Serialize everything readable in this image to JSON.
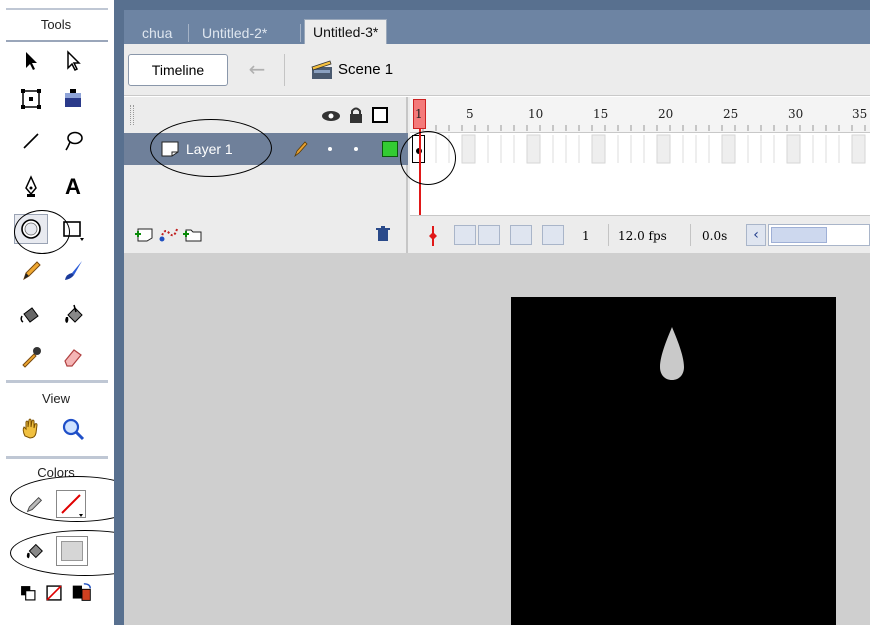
{
  "tools_panel": {
    "title": "Tools",
    "sections": {
      "view": "View",
      "colors": "Colors"
    },
    "tools": [
      {
        "name": "selection-tool",
        "icon": "arrow-icon"
      },
      {
        "name": "subselection-tool",
        "icon": "hollow-arrow-icon"
      },
      {
        "name": "free-transform-tool",
        "icon": "transform-icon"
      },
      {
        "name": "gradient-transform-tool",
        "icon": "gradient-transform-icon"
      },
      {
        "name": "line-tool",
        "icon": "line-icon"
      },
      {
        "name": "lasso-tool",
        "icon": "lasso-icon"
      },
      {
        "name": "pen-tool",
        "icon": "pen-icon"
      },
      {
        "name": "text-tool",
        "icon": "text-icon",
        "label": "A"
      },
      {
        "name": "oval-tool",
        "icon": "oval-icon",
        "selected": true
      },
      {
        "name": "rectangle-tool",
        "icon": "rectangle-icon"
      },
      {
        "name": "pencil-tool",
        "icon": "pencil-icon"
      },
      {
        "name": "brush-tool",
        "icon": "brush-icon"
      },
      {
        "name": "ink-bottle-tool",
        "icon": "ink-bottle-icon"
      },
      {
        "name": "paint-bucket-tool",
        "icon": "paint-bucket-icon"
      },
      {
        "name": "eyedropper-tool",
        "icon": "eyedropper-icon"
      },
      {
        "name": "eraser-tool",
        "icon": "eraser-icon"
      }
    ],
    "stroke_color": "none",
    "fill_color": "#d6d6d6"
  },
  "document_tabs": [
    {
      "label": "chua",
      "active": false
    },
    {
      "label": "Untitled-2*",
      "active": false
    },
    {
      "label": "Untitled-3*",
      "active": true
    }
  ],
  "edit_bar": {
    "timeline_button": "Timeline",
    "scene_label": "Scene 1"
  },
  "timeline": {
    "ruler_labels": [
      "1",
      "5",
      "10",
      "15",
      "20",
      "25",
      "30",
      "35"
    ],
    "layers": [
      {
        "name": "Layer 1",
        "color": "#33cc33"
      }
    ],
    "current_frame": "1",
    "frame_rate": "12.0 fps",
    "elapsed_time": "0.0s"
  },
  "stage": {
    "background": "#000000",
    "shape_color": "#c9c9c9"
  },
  "colors": {
    "frame_blue": "#58708f",
    "layer_highlight": "#6f809a",
    "playhead": "#e01818"
  }
}
